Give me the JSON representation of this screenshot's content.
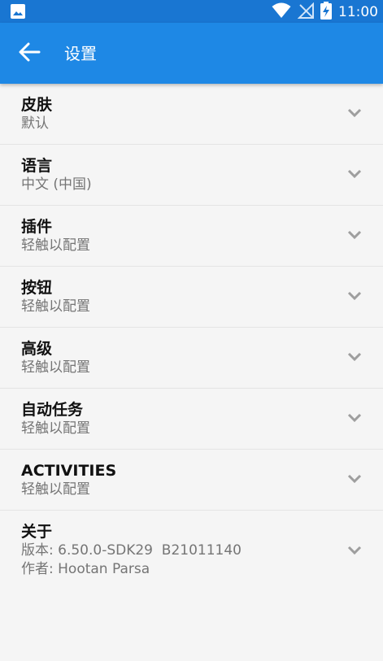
{
  "status": {
    "time": "11:00"
  },
  "appbar": {
    "title": "设置"
  },
  "items": [
    {
      "label": "皮肤",
      "value": "默认"
    },
    {
      "label": "语言",
      "value": "中文 (中国)"
    },
    {
      "label": "插件",
      "value": "轻触以配置"
    },
    {
      "label": "按钮",
      "value": "轻触以配置"
    },
    {
      "label": "高级",
      "value": "轻触以配置"
    },
    {
      "label": "自动任务",
      "value": "轻触以配置"
    },
    {
      "label": "ACTIVITIES",
      "value": "轻触以配置"
    },
    {
      "label": "关于",
      "value": "版本: 6.50.0-SDK29  B21011140",
      "value2": "作者: Hootan Parsa"
    }
  ],
  "colors": {
    "statusbar": "#1976d2",
    "appbar": "#1e88e5",
    "background": "#f5f5f5"
  },
  "icons": {
    "back": "arrow-back-icon",
    "expand": "chevron-down-icon",
    "gallery": "image-icon",
    "wifi": "wifi-icon",
    "signal": "no-signal-icon",
    "battery": "battery-charging-icon"
  }
}
